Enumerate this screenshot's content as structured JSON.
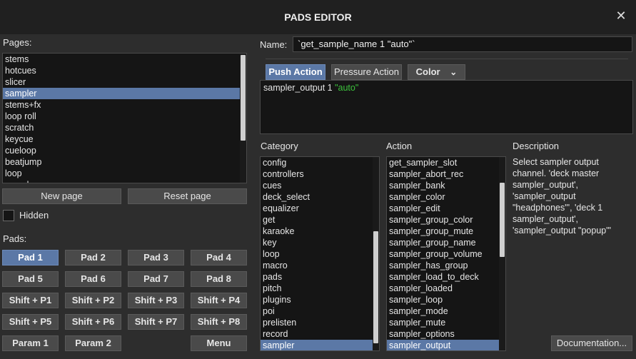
{
  "window": {
    "title": "PADS EDITOR",
    "close_glyph": "✕"
  },
  "pages": {
    "label": "Pages:",
    "items": [
      "stems",
      "hotcues",
      "slicer",
      "sampler",
      "stems+fx",
      "loop roll",
      "scratch",
      "keycue",
      "cueloop",
      "beatjump",
      "loop",
      "sampler"
    ],
    "selected_index": 3,
    "new_page_label": "New page",
    "reset_page_label": "Reset page",
    "hidden_label": "Hidden",
    "hidden_checked": false
  },
  "pads": {
    "label": "Pads:",
    "rows": [
      [
        "Pad 1",
        "Pad 2",
        "Pad 3",
        "Pad 4"
      ],
      [
        "Pad 5",
        "Pad 6",
        "Pad 7",
        "Pad 8"
      ],
      [
        "Shift + P1",
        "Shift + P2",
        "Shift + P3",
        "Shift + P4"
      ],
      [
        "Shift + P5",
        "Shift + P6",
        "Shift + P7",
        "Shift + P8"
      ]
    ],
    "param1_label": "Param 1",
    "param2_label": "Param 2",
    "menu_label": "Menu",
    "active_pad": "Pad 1"
  },
  "name": {
    "label": "Name:",
    "value": "`get_sample_name 1 \"auto\"`"
  },
  "tabs": {
    "push_action": "Push Action",
    "pressure_action": "Pressure Action",
    "color": "Color",
    "color_arrow": "⌄"
  },
  "script": {
    "command": "sampler_output 1",
    "argument": "\"auto\"",
    "argument_color": "#3cc23c"
  },
  "category": {
    "label": "Category",
    "items": [
      "config",
      "controllers",
      "cues",
      "deck_select",
      "equalizer",
      "get",
      "karaoke",
      "key",
      "loop",
      "macro",
      "pads",
      "pitch",
      "plugins",
      "poi",
      "prelisten",
      "record",
      "sampler"
    ],
    "selected": "sampler"
  },
  "action": {
    "label": "Action",
    "items": [
      "get_sampler_slot",
      "sampler_abort_rec",
      "sampler_bank",
      "sampler_color",
      "sampler_edit",
      "sampler_group_color",
      "sampler_group_mute",
      "sampler_group_name",
      "sampler_group_volume",
      "sampler_has_group",
      "sampler_load_to_deck",
      "sampler_loaded",
      "sampler_loop",
      "sampler_mode",
      "sampler_mute",
      "sampler_options",
      "sampler_output"
    ],
    "selected": "sampler_output"
  },
  "description": {
    "label": "Description",
    "text": "Select sampler output channel. 'deck master sampler_output', 'sampler_output \"headphones\"', 'deck 1 sampler_output', 'sampler_output \"popup\"'"
  },
  "documentation_label": "Documentation...",
  "colors": {
    "accent": "#5b78a6",
    "background": "#2d2d2d",
    "field": "#151515"
  }
}
